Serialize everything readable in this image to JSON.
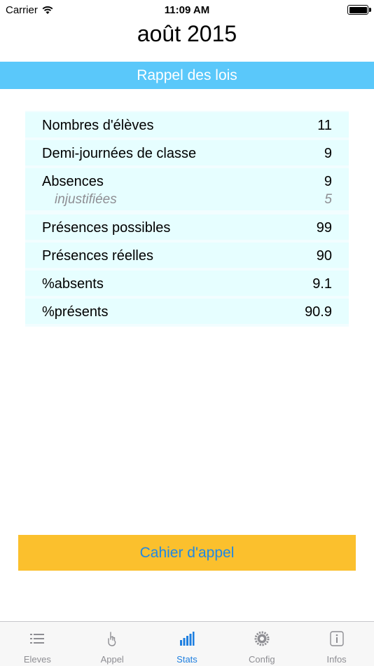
{
  "status_bar": {
    "carrier": "Carrier",
    "time": "11:09 AM"
  },
  "header": {
    "title": "août 2015"
  },
  "banner": {
    "label": "Rappel des lois"
  },
  "stats": {
    "rows": [
      {
        "label": "Nombres d'élèves",
        "value": "11"
      },
      {
        "label": "Demi-journées de classe",
        "value": "9"
      },
      {
        "label": "Absences",
        "value": "9",
        "sub_label": "injustifiées",
        "sub_value": "5"
      },
      {
        "label": "Présences possibles",
        "value": "99"
      },
      {
        "label": "Présences réelles",
        "value": "90"
      },
      {
        "label": "%absents",
        "value": "9.1"
      },
      {
        "label": "%présents",
        "value": "90.9"
      }
    ]
  },
  "action": {
    "label": "Cahier d'appel"
  },
  "tab_bar": {
    "tabs": [
      {
        "label": "Eleves",
        "icon": "list-icon",
        "active": false
      },
      {
        "label": "Appel",
        "icon": "raised-hand-icon",
        "active": false
      },
      {
        "label": "Stats",
        "icon": "bar-chart-icon",
        "active": true
      },
      {
        "label": "Config",
        "icon": "gear-icon",
        "active": false
      },
      {
        "label": "Infos",
        "icon": "info-icon",
        "active": false
      }
    ]
  },
  "colors": {
    "banner": "#5ac8fa",
    "button": "#fbc02d",
    "button_text": "#1e88e5",
    "row": "#e6feff",
    "tab_active": "#1e7fe0",
    "tab_inactive": "#8e8e93"
  }
}
